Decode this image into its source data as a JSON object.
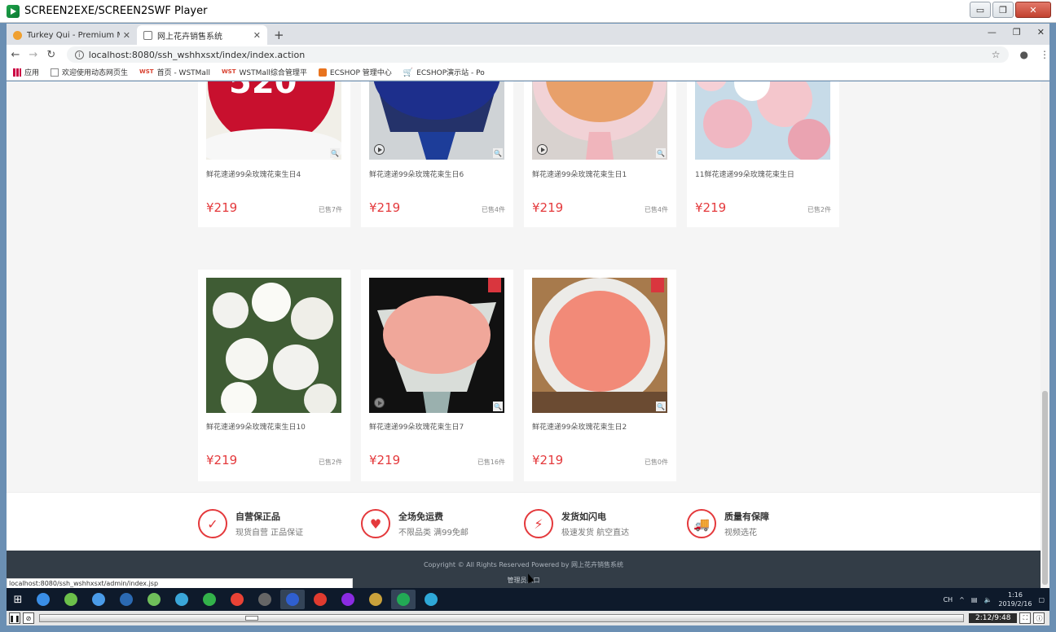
{
  "player": {
    "title": "SCREEN2EXE/SCREEN2SWF Player",
    "min": "▭",
    "restore": "❐",
    "close": "✕",
    "time": "2:12/9:48",
    "progress_fraction": 0.225
  },
  "browser": {
    "tabs": [
      {
        "label": "Turkey Qui - Premium Multipur",
        "active": false
      },
      {
        "label": "网上花卉销售系统",
        "active": true
      }
    ],
    "new_tab": "+",
    "url": "localhost:8080/ssh_wshhxsxt/index/index.action",
    "status_url": "localhost:8080/ssh_wshhxsxt/admin/index.jsp",
    "bookmarks": [
      {
        "label": "应用",
        "icon": "apps-icon"
      },
      {
        "label": "欢迎使用动态网页生",
        "icon": "doc-icon"
      },
      {
        "label": "首页 - WSTMall",
        "icon": "wst-icon"
      },
      {
        "label": "WSTMall综合管理平",
        "icon": "wst-icon"
      },
      {
        "label": "ECSHOP 管理中心",
        "icon": "ecshop-icon"
      },
      {
        "label": "ECSHOP演示站 - Po",
        "icon": "cart-icon"
      }
    ],
    "wst_text": "WST"
  },
  "products_row1": [
    {
      "name": "鲜花速递99朵玫瑰花束生日4",
      "price": "¥219",
      "sold": "已售7件",
      "colors": [
        "#c8102e",
        "#f4f4f4"
      ]
    },
    {
      "name": "鲜花速递99朵玫瑰花束生日6",
      "price": "¥219",
      "sold": "已售4件",
      "colors": [
        "#1d2f8c",
        "#24326a"
      ]
    },
    {
      "name": "鲜花速递99朵玫瑰花束生日1",
      "price": "¥219",
      "sold": "已售4件",
      "colors": [
        "#e8a06a",
        "#f1d2d6"
      ]
    },
    {
      "name": "11鲜花速递99朵玫瑰花束生日",
      "price": "¥219",
      "sold": "已售2件",
      "colors": [
        "#f0b7c2",
        "#c7dbe8"
      ]
    }
  ],
  "products_row2": [
    {
      "name": "鲜花速递99朵玫瑰花束生日10",
      "price": "¥219",
      "sold": "已售2件",
      "colors": [
        "#f2f2ee",
        "#3f5c34"
      ]
    },
    {
      "name": "鲜花速递99朵玫瑰花束生日7",
      "price": "¥219",
      "sold": "已售16件",
      "colors": [
        "#f0a79a",
        "#111111"
      ]
    },
    {
      "name": "鲜花速递99朵玫瑰花束生日2",
      "price": "¥219",
      "sold": "已售0件",
      "colors": [
        "#f28a78",
        "#d8d0cc"
      ]
    }
  ],
  "services": [
    {
      "title": "自营保正品",
      "sub": "现货自营 正品保证",
      "icon": "shield-icon",
      "glyph": "✓"
    },
    {
      "title": "全场免运费",
      "sub": "不限品类 满99免邮",
      "icon": "heart-hand-icon",
      "glyph": "♥"
    },
    {
      "title": "发货如闪电",
      "sub": "极速发货 航空直达",
      "icon": "lightning-icon",
      "glyph": "⚡"
    },
    {
      "title": "质量有保障",
      "sub": "视频选花",
      "icon": "truck-icon",
      "glyph": "🚚"
    }
  ],
  "footer": {
    "copyright": "Copyright © All Rights Reserved   Powered by 网上花卉销售系统",
    "admin_link": "管理员入口"
  },
  "taskbar": {
    "clock_time": "1:16",
    "clock_date": "2019/2/16",
    "ime": "CH",
    "apps": [
      "#3a8ee6",
      "#6cc04a",
      "#4a9be8",
      "#2b6ab3",
      "#6fbf5a",
      "#3aa6d9",
      "#33b24a",
      "#e94235",
      "#666",
      "#2f5fd0",
      "#e03b2f",
      "#8a2be2",
      "#c9a13b",
      "#22aa55",
      "#2ea8d8"
    ]
  },
  "accent_color": "#e4393c"
}
